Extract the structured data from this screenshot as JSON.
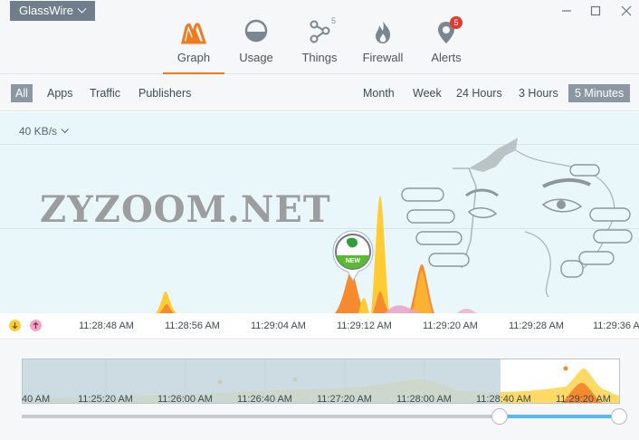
{
  "app": {
    "menu_label": "GlassWire"
  },
  "window": {
    "minimize_icon": "minimize-icon",
    "maximize_icon": "maximize-icon",
    "close_icon": "close-icon"
  },
  "tabs": [
    {
      "label": "Graph",
      "icon": "graph-flame-icon",
      "active": true
    },
    {
      "label": "Usage",
      "icon": "usage-gauge-icon",
      "active": false
    },
    {
      "label": "Things",
      "icon": "things-network-icon",
      "badge": "5",
      "active": false
    },
    {
      "label": "Firewall",
      "icon": "firewall-flame-icon",
      "active": false
    },
    {
      "label": "Alerts",
      "icon": "alerts-pin-icon",
      "badge": "5",
      "active": false
    }
  ],
  "filters": {
    "left": [
      {
        "label": "All",
        "selected": true
      },
      {
        "label": "Apps",
        "selected": false
      },
      {
        "label": "Traffic",
        "selected": false
      },
      {
        "label": "Publishers",
        "selected": false
      }
    ],
    "right": [
      {
        "label": "Month",
        "selected": false
      },
      {
        "label": "Week",
        "selected": false
      },
      {
        "label": "24 Hours",
        "selected": false
      },
      {
        "label": "3 Hours",
        "selected": false
      },
      {
        "label": "5 Minutes",
        "selected": true
      }
    ]
  },
  "graph": {
    "scale_label": "40 KB/s",
    "watermark": "ZYZOOM.NET",
    "new_pin_label": "NEW",
    "colors": {
      "incoming": "#f58a2e",
      "outgoing": "#ffcc33",
      "background": "#eaf7fa",
      "accent": "#f07a1f"
    }
  },
  "time_axis": {
    "download_icon": "download-arrow-icon",
    "upload_icon": "upload-arrow-icon",
    "labels": [
      "11:28:48 AM",
      "11:28:56 AM",
      "11:29:04 AM",
      "11:29:12 AM",
      "11:29:20 AM",
      "11:29:28 AM",
      "11:29:36 A"
    ]
  },
  "overview": {
    "labels": [
      "40 AM",
      "11:25:20 AM",
      "11:26:00 AM",
      "11:26:40 AM",
      "11:27:20 AM",
      "11:28:00 AM",
      "11:28:40 AM",
      "11:29:20 AM"
    ]
  }
}
